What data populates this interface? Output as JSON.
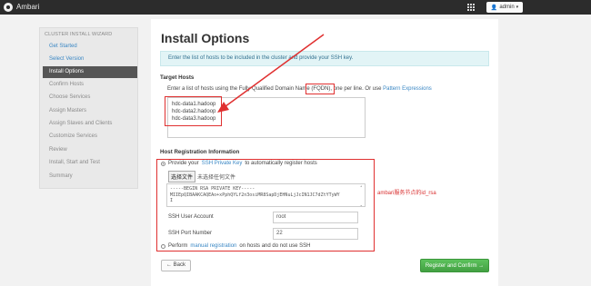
{
  "topbar": {
    "brand": "Ambari",
    "admin_label": "admin",
    "icons": [
      "ambari-logo-icon",
      "apps-grid-icon",
      "user-icon",
      "caret-down-icon"
    ]
  },
  "sidebar": {
    "title": "CLUSTER INSTALL WIZARD",
    "items": [
      {
        "label": "Get Started",
        "state": "link"
      },
      {
        "label": "Select Version",
        "state": "link"
      },
      {
        "label": "Install Options",
        "state": "active"
      },
      {
        "label": "Confirm Hosts",
        "state": "disabled"
      },
      {
        "label": "Choose Services",
        "state": "disabled"
      },
      {
        "label": "Assign Masters",
        "state": "disabled"
      },
      {
        "label": "Assign Slaves and Clients",
        "state": "disabled"
      },
      {
        "label": "Customize Services",
        "state": "disabled"
      },
      {
        "label": "Review",
        "state": "disabled"
      },
      {
        "label": "Install, Start and Test",
        "state": "disabled"
      },
      {
        "label": "Summary",
        "state": "disabled"
      }
    ]
  },
  "main": {
    "title": "Install Options",
    "info": "Enter the list of hosts to be included in the cluster and provide your SSH key.",
    "target_hosts": {
      "heading": "Target Hosts",
      "hint_pre": "Enter a list of hosts using the Fully Qualified Domain Name (",
      "hint_fqdn": "FQDN",
      "hint_mid": "), one per line. Or use ",
      "hint_link": "Pattern Expressions",
      "hosts": [
        "hdc-data1.hadoop",
        "hdc-data2.hadoop",
        "hdc-data3.hadoop"
      ]
    },
    "registration": {
      "heading": "Host Registration Information",
      "option1_pre": "Provide your",
      "option1_link": "SSH Private Key",
      "option1_post": "to automatically register hosts",
      "choose_file": "选择文件",
      "no_file": "未选择任何文件",
      "key_lines": [
        "-----BEGIN RSA PRIVATE KEY-----",
        "MIIEpQIBAAKCAQEAo+xPphQYLf2n3osiMR8SapDjEHNuLjJcIN1JC7dZtYTyWY",
        "I"
      ],
      "ssh_user_label": "SSH User Account",
      "ssh_user": "root",
      "ssh_port_label": "SSH Port Number",
      "ssh_port": "22",
      "option2_pre": "Perform",
      "option2_link": "manual registration",
      "option2_post": "on hosts and do not use SSH"
    },
    "back_label": "← Back",
    "register_label": "Register and Confirm →"
  },
  "annotation": {
    "note": "ambari服务节点的id_rsa",
    "color": "#e03030"
  },
  "colors": {
    "topbar": "#2c2c2c",
    "link": "#3a87c4",
    "active_item": "#555555",
    "info_bg": "#e2f4f6",
    "primary_button": "#42a042"
  }
}
